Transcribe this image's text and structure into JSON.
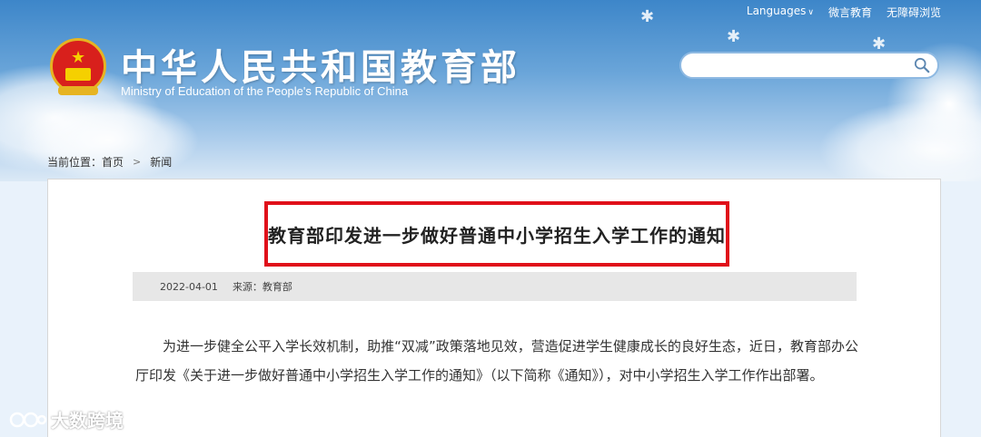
{
  "header": {
    "site_title": "中华人民共和国教育部",
    "site_subtitle": "Ministry of Education of the People's Republic of China",
    "top_links": {
      "languages": "Languages",
      "weiyan": "微言教育",
      "accessible": "无障碍浏览"
    },
    "search": {
      "placeholder": "",
      "value": ""
    }
  },
  "breadcrumb": {
    "prefix": "当前位置：",
    "home": "首页",
    "separator": ">",
    "current": "新闻"
  },
  "article": {
    "title": "教育部印发进一步做好普通中小学招生入学工作的通知",
    "date": "2022-04-01",
    "source": "来源：教育部",
    "body": "为进一步健全公平入学长效机制，助推“双减”政策落地见效，营造促进学生健康成长的良好生态，近日，教育部办公厅印发《关于进一步做好普通中小学招生入学工作的通知》（以下简称《通知》），对中小学招生入学工作作出部署。"
  },
  "watermark": {
    "text": "大数跨境"
  },
  "colors": {
    "highlight_border": "#e0101a",
    "banner_sky": "#3d86c9",
    "meta_bar": "#e7e7e7"
  }
}
